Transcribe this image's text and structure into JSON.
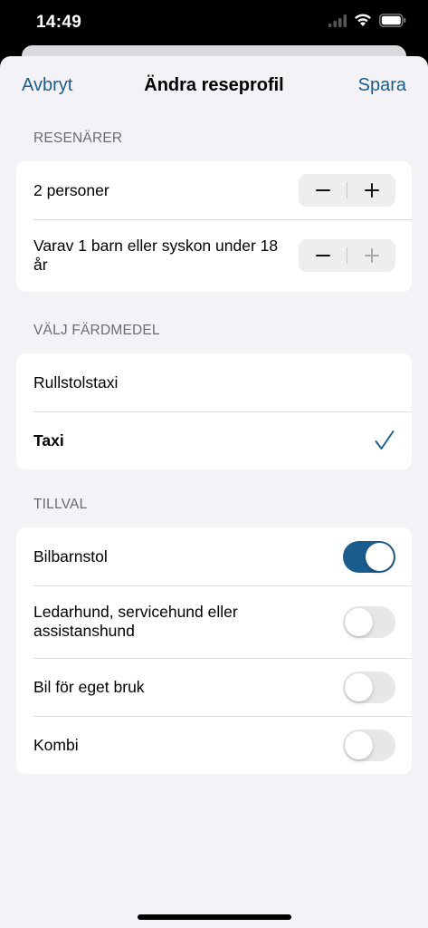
{
  "status_bar": {
    "time": "14:49",
    "icons": [
      "signal-icon",
      "wifi-icon",
      "battery-icon"
    ]
  },
  "nav": {
    "cancel_label": "Avbryt",
    "title": "Ändra reseprofil",
    "save_label": "Spara"
  },
  "travelers": {
    "header": "RESENÄRER",
    "rows": [
      {
        "label": "2 personer",
        "value": 2,
        "minus_enabled": true,
        "plus_enabled": true
      },
      {
        "label": "Varav 1 barn eller syskon under 18 år",
        "value": 1,
        "minus_enabled": true,
        "plus_enabled": false
      }
    ]
  },
  "transport": {
    "header": "VÄLJ FÄRDMEDEL",
    "options": [
      {
        "label": "Rullstolstaxi",
        "selected": false
      },
      {
        "label": "Taxi",
        "selected": true
      }
    ]
  },
  "extras": {
    "header": "TILLVAL",
    "options": [
      {
        "label": "Bilbarnstol",
        "on": true
      },
      {
        "label": "Ledarhund, servicehund eller assistanshund",
        "on": false
      },
      {
        "label": "Bil för eget bruk",
        "on": false
      },
      {
        "label": "Kombi",
        "on": false
      }
    ]
  },
  "colors": {
    "accent": "#1b5c8f",
    "background": "#f2f2f7",
    "toggle_off": "#e7e7ea"
  }
}
